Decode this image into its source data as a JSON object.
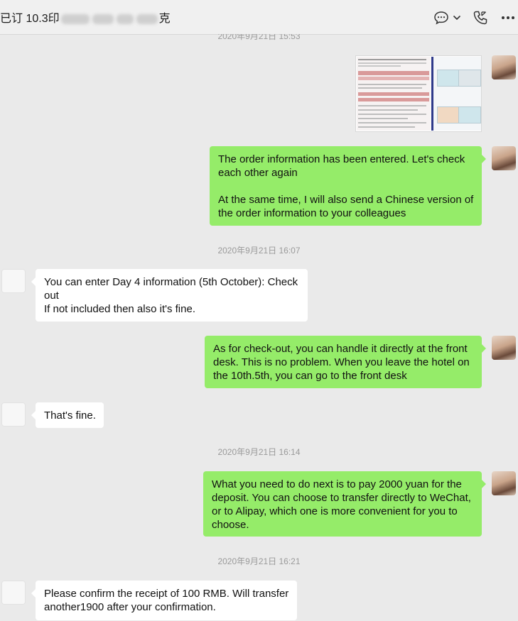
{
  "header": {
    "title_prefix": "已订 10.3印",
    "title_suffix": "克",
    "icons": [
      "chat-bubble-icon",
      "chevron-down-icon",
      "phone-icon",
      "more-icon"
    ]
  },
  "messages": [
    {
      "id": "t0",
      "type": "time",
      "text": "2020年9月21日 15:53"
    },
    {
      "id": "m0",
      "type": "image",
      "side": "me"
    },
    {
      "id": "m1",
      "type": "text",
      "side": "me",
      "lines": [
        "The order information has been entered. Let's check",
        "each other again",
        "",
        "At the same time, I will also send a Chinese version of",
        "the order information to your colleagues"
      ]
    },
    {
      "id": "t1",
      "type": "time",
      "text": "2020年9月21日 16:07"
    },
    {
      "id": "m2",
      "type": "text",
      "side": "other",
      "lines": [
        "You can enter Day 4 information (5th October): Check",
        "out",
        "If not included then also it's fine."
      ]
    },
    {
      "id": "m3",
      "type": "text",
      "side": "me",
      "lines": [
        "As for check-out, you can handle it directly at the front",
        "desk. This is no problem. When you leave the hotel on",
        "the 10th.5th, you can go to the front desk"
      ]
    },
    {
      "id": "m4",
      "type": "text",
      "side": "other",
      "lines": [
        "That's fine."
      ]
    },
    {
      "id": "t2",
      "type": "time",
      "text": "2020年9月21日 16:14"
    },
    {
      "id": "m5",
      "type": "text",
      "side": "me",
      "lines": [
        "What you need to do next is to pay 2000 yuan for the",
        "deposit. You can choose to transfer directly to WeChat,",
        "or to Alipay, which one is more convenient for you to",
        "choose."
      ]
    },
    {
      "id": "t3",
      "type": "time",
      "text": "2020年9月21日 16:21"
    },
    {
      "id": "m6",
      "type": "text",
      "side": "other",
      "lines": [
        "Please confirm the receipt of 100 RMB. Will transfer",
        "another1900 after your confirmation."
      ]
    }
  ],
  "colors": {
    "self_bubble": "#95ec69",
    "other_bubble": "#ffffff",
    "background": "#eaeaea",
    "timestamp": "#9a9a9a"
  }
}
